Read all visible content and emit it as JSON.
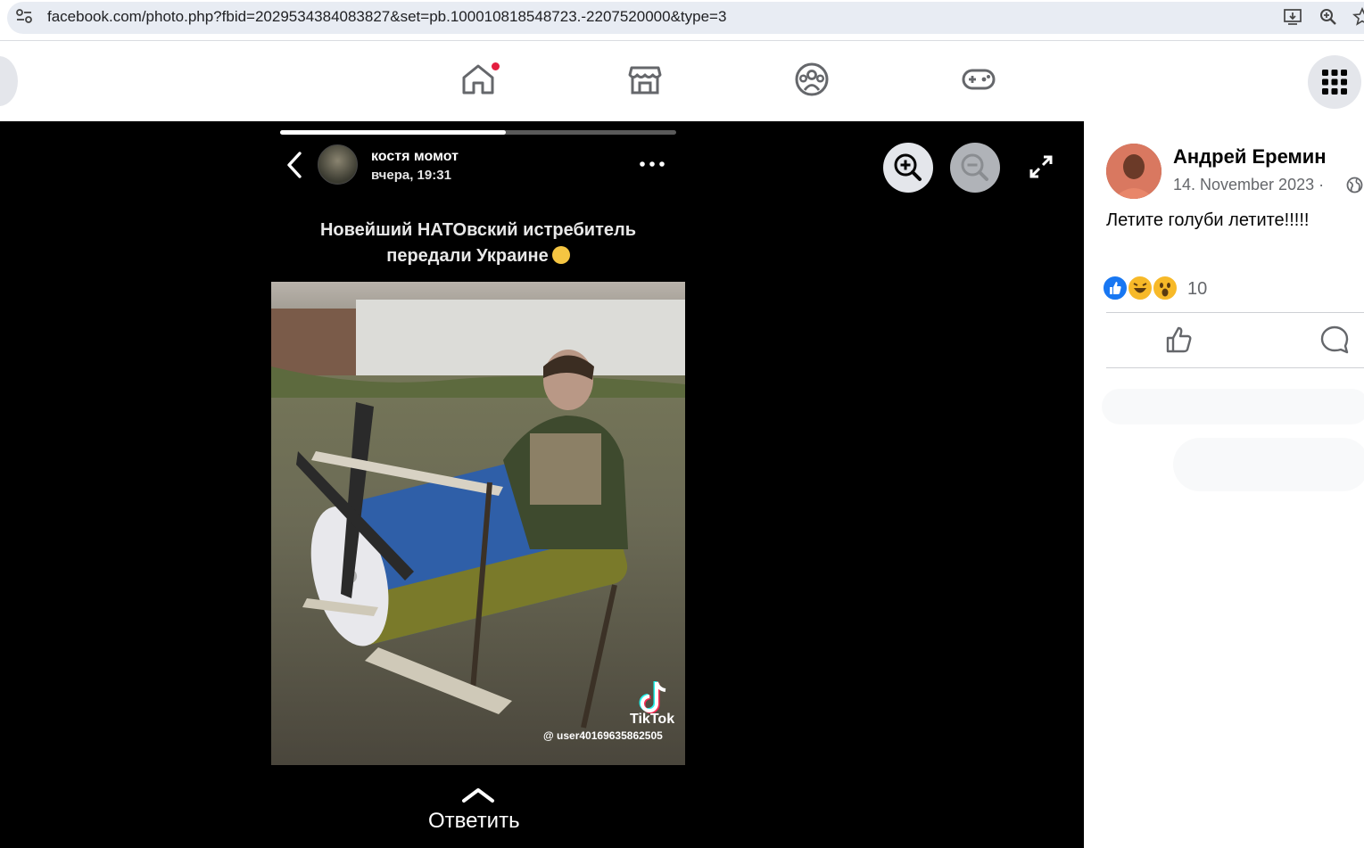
{
  "browser": {
    "url": "facebook.com/photo.php?fbid=2029534384083827&set=pb.100010818548723.-2207520000&type=3",
    "icons": [
      "site-controls-icon",
      "install-app-icon",
      "zoom-icon",
      "bookmark-star-icon"
    ]
  },
  "fb_nav": {
    "icons": [
      "back-icon",
      "home-icon",
      "marketplace-icon",
      "groups-icon",
      "gaming-icon",
      "menu-grid-icon"
    ],
    "home_has_notification": true,
    "notification_color": "#e41e3f"
  },
  "story": {
    "progress": 0.57,
    "author": "костя момот",
    "time": "вчера, 19:31",
    "caption_line1": "Новейший НАТОвский истребитель",
    "caption_line2": "передали Украине",
    "caption_emoji": "thinking-face-emoji",
    "watermark_brand": "TikTok",
    "watermark_user": "@ user40169635862505",
    "reply_label": "Ответить"
  },
  "viewer_controls": {
    "zoom_in": "zoom-in-icon",
    "zoom_out": "zoom-out-icon",
    "fullscreen": "fullscreen-icon"
  },
  "post": {
    "author": "Андрей Еремин",
    "date": "14. November 2023 ·",
    "audience_icon": "globe-icon",
    "text": "Летите голуби летите!!!!!",
    "reactions": [
      "like",
      "haha",
      "wow"
    ],
    "reaction_count": "10",
    "actions": [
      "like-icon",
      "comment-icon"
    ]
  },
  "colors": {
    "fb_blue": "#1877f2",
    "viewer_bg": "#000000",
    "secondary_text": "#65676b"
  }
}
